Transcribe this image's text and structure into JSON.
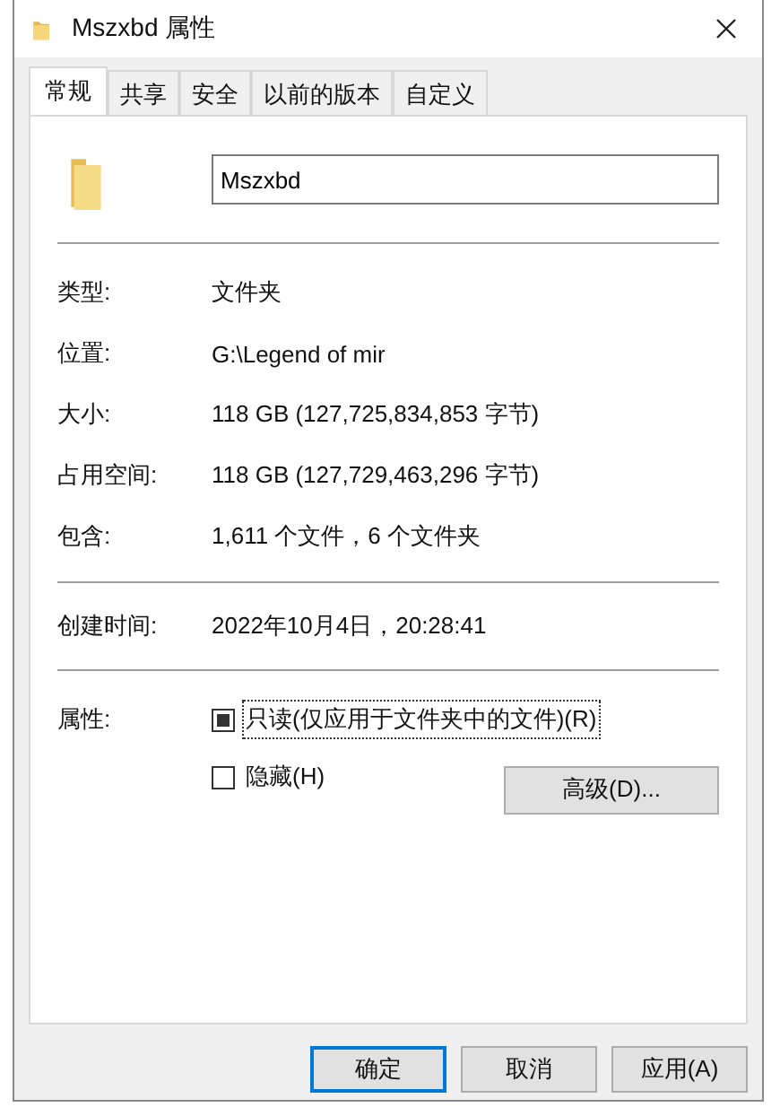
{
  "window": {
    "title": "Mszxbd 属性"
  },
  "tabs": [
    {
      "label": "常规",
      "selected": true
    },
    {
      "label": "共享",
      "selected": false
    },
    {
      "label": "安全",
      "selected": false
    },
    {
      "label": "以前的版本",
      "selected": false
    },
    {
      "label": "自定义",
      "selected": false
    }
  ],
  "name_field": {
    "value": "Mszxbd"
  },
  "details": [
    {
      "label": "类型:",
      "value": "文件夹"
    },
    {
      "label": "位置:",
      "value": "G:\\Legend of mir"
    },
    {
      "label": "大小:",
      "value": "118 GB (127,725,834,853 字节)"
    },
    {
      "label": "占用空间:",
      "value": "118 GB (127,729,463,296 字节)"
    },
    {
      "label": "包含:",
      "value": "1,611 个文件，6 个文件夹"
    }
  ],
  "created": {
    "label": "创建时间:",
    "value": "2022年10月4日，20:28:41"
  },
  "attributes": {
    "label": "属性:",
    "checkboxes": [
      {
        "label": "只读(仅应用于文件夹中的文件)(R)",
        "checked": true,
        "focused": true
      },
      {
        "label": "隐藏(H)",
        "checked": false,
        "focused": false
      }
    ],
    "advanced_button": "高级(D)..."
  },
  "buttons": [
    {
      "label": "确定",
      "default": true
    },
    {
      "label": "取消",
      "default": false
    },
    {
      "label": "应用(A)",
      "default": false
    }
  ]
}
